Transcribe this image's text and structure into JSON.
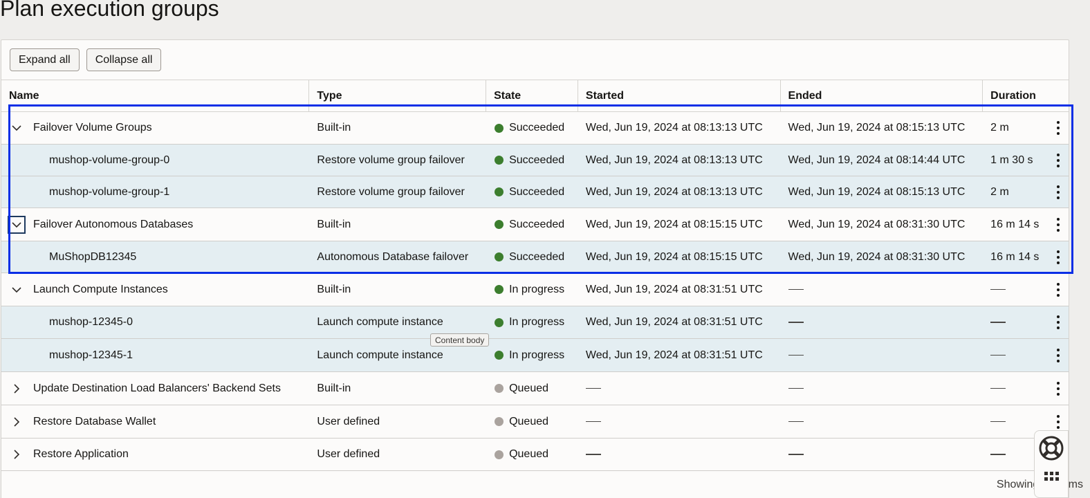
{
  "page": {
    "title": "Plan execution groups"
  },
  "toolbar": {
    "expand_all": "Expand all",
    "collapse_all": "Collapse all"
  },
  "columns": {
    "name": "Name",
    "type": "Type",
    "state": "State",
    "started": "Started",
    "ended": "Ended",
    "duration": "Duration"
  },
  "rows": [
    {
      "kind": "parent",
      "expanded": true,
      "name": "Failover Volume Groups",
      "type": "Built-in",
      "state": "Succeeded",
      "status": "green",
      "started": "Wed, Jun 19, 2024 at 08:13:13 UTC",
      "ended": "Wed, Jun 19, 2024 at 08:15:13 UTC",
      "duration": "2 m"
    },
    {
      "kind": "child",
      "name": "mushop-volume-group-0",
      "type": "Restore volume group failover",
      "state": "Succeeded",
      "status": "green",
      "started": "Wed, Jun 19, 2024 at 08:13:13 UTC",
      "ended": "Wed, Jun 19, 2024 at 08:14:44 UTC",
      "duration": "1 m 30 s"
    },
    {
      "kind": "child",
      "name": "mushop-volume-group-1",
      "type": "Restore volume group failover",
      "state": "Succeeded",
      "status": "green",
      "started": "Wed, Jun 19, 2024 at 08:13:13 UTC",
      "ended": "Wed, Jun 19, 2024 at 08:15:13 UTC",
      "duration": "2 m"
    },
    {
      "kind": "parent",
      "expanded": true,
      "focused": true,
      "name": "Failover Autonomous Databases",
      "type": "Built-in",
      "state": "Succeeded",
      "status": "green",
      "started": "Wed, Jun 19, 2024 at 08:15:15 UTC",
      "ended": "Wed, Jun 19, 2024 at 08:31:30 UTC",
      "duration": "16 m 14 s"
    },
    {
      "kind": "child",
      "name": "MuShopDB12345",
      "type": "Autonomous Database failover",
      "state": "Succeeded",
      "status": "green",
      "started": "Wed, Jun 19, 2024 at 08:15:15 UTC",
      "ended": "Wed, Jun 19, 2024 at 08:31:30 UTC",
      "duration": "16 m 14 s"
    },
    {
      "kind": "parent",
      "expanded": true,
      "name": "Launch Compute Instances",
      "type": "Built-in",
      "state": "In progress",
      "status": "green",
      "started": "Wed, Jun 19, 2024 at 08:31:51 UTC",
      "ended": "",
      "duration": ""
    },
    {
      "kind": "child",
      "name": "mushop-12345-0",
      "type": "Launch compute instance",
      "state": "In progress",
      "status": "green",
      "started": "Wed, Jun 19, 2024 at 08:31:51 UTC",
      "ended": "",
      "duration": ""
    },
    {
      "kind": "child",
      "name": "mushop-12345-1",
      "type": "Launch compute instance",
      "state": "In progress",
      "status": "green",
      "started": "Wed, Jun 19, 2024 at 08:31:51 UTC",
      "ended": "",
      "duration": ""
    },
    {
      "kind": "parent",
      "expanded": false,
      "name": "Update Destination Load Balancers' Backend Sets",
      "type": "Built-in",
      "state": "Queued",
      "status": "gray",
      "started": "",
      "ended": "",
      "duration": ""
    },
    {
      "kind": "parent",
      "expanded": false,
      "name": "Restore Database Wallet",
      "type": "User defined",
      "state": "Queued",
      "status": "gray",
      "started": "",
      "ended": "",
      "duration": ""
    },
    {
      "kind": "parent",
      "expanded": false,
      "name": "Restore Application",
      "type": "User defined",
      "state": "Queued",
      "status": "gray",
      "started": "",
      "ended": "",
      "duration": ""
    }
  ],
  "tooltip": {
    "text": "Content body"
  },
  "footer": {
    "showing": "Showing 11 items"
  },
  "colors": {
    "succeeded": "#3c7e2e",
    "queued": "#aaa39e",
    "child_row_bg": "#e4eef2",
    "highlight_box": "#0a2ee6"
  },
  "icons": {
    "expanded": "chevron-down-icon",
    "collapsed": "chevron-right-icon",
    "row_actions": "kebab-menu-icon",
    "help": "lifebuoy-icon",
    "apps": "grid-icon"
  }
}
